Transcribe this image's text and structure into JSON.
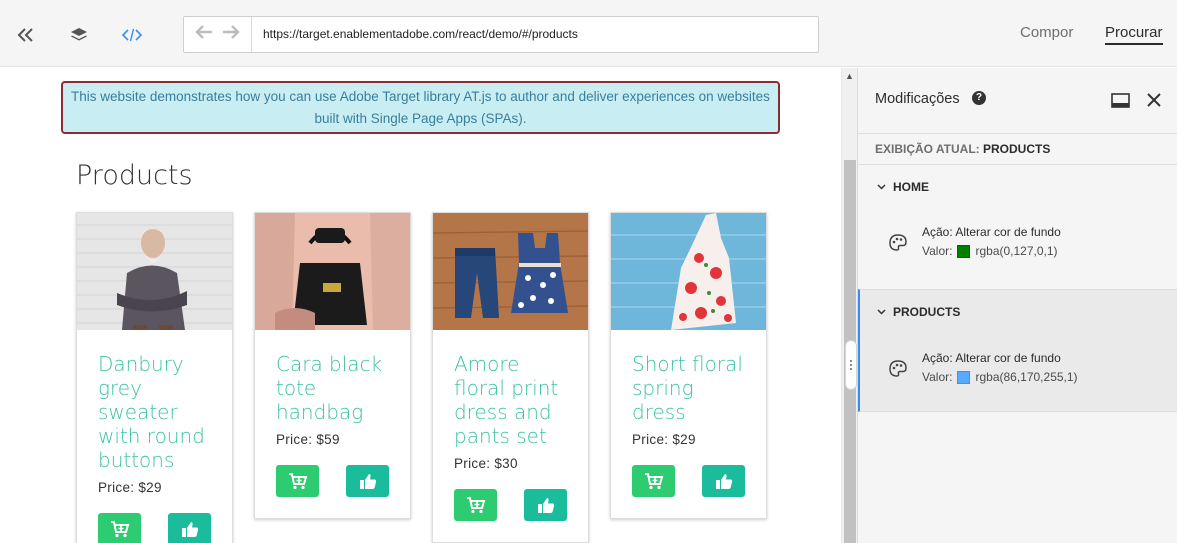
{
  "toolbar": {
    "url": "https://target.enablementadobe.com/react/demo/#/products",
    "modes": [
      {
        "label": "Compor",
        "active": false
      },
      {
        "label": "Procurar",
        "active": true
      }
    ]
  },
  "site": {
    "banner": "This website demonstrates how you can use Adobe Target library AT.js to author and deliver experiences on websites built with Single Page Apps (SPAs).",
    "heading": "Products",
    "products": [
      {
        "name": "Danbury grey sweater with round buttons",
        "price": "Price: $29"
      },
      {
        "name": "Cara black tote handbag",
        "price": "Price: $59"
      },
      {
        "name": "Amore floral print dress and pants set",
        "price": "Price: $30"
      },
      {
        "name": "Short floral spring dress",
        "price": "Price: $29"
      }
    ]
  },
  "panel": {
    "title": "Modificações",
    "help": "?",
    "current_view_label": "EXIBIÇÃO ATUAL:",
    "current_view_value": "PRODUCTS",
    "groups": [
      {
        "name": "HOME",
        "action": "Ação: Alterar cor de fundo",
        "value_label": "Valor:",
        "value": "rgba(0,127,0,1)",
        "swatch_color": "#007f00"
      },
      {
        "name": "PRODUCTS",
        "action": "Ação: Alterar cor de fundo",
        "value_label": "Valor:",
        "value": "rgba(86,170,255,1)",
        "swatch_color": "#56aaff"
      }
    ]
  },
  "colors": {
    "accent_teal": "#3bc2a5",
    "cart_green": "#2ecc71",
    "like_teal": "#1abc9c",
    "banner_bg": "#c8edf3",
    "banner_border": "#8e2c34",
    "selection_blue": "#378ef0"
  }
}
